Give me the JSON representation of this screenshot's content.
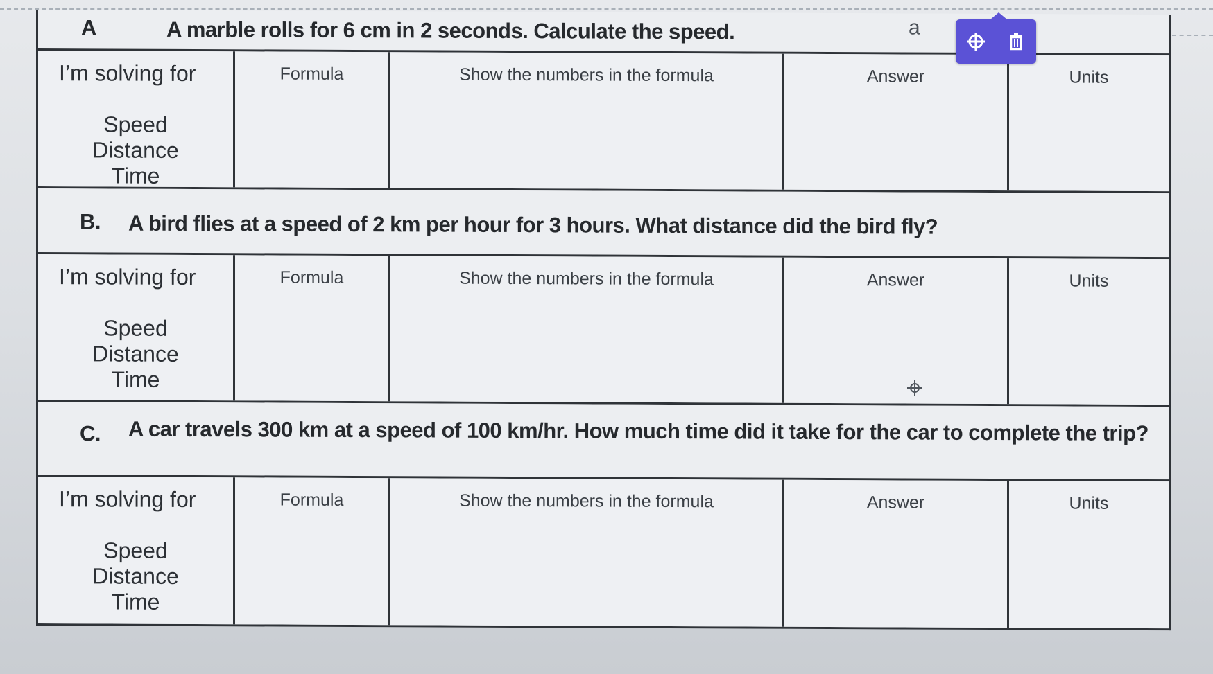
{
  "questions": [
    {
      "letter": "A",
      "text": "A marble rolls for 6 cm in 2 seconds.  Calculate the speed."
    },
    {
      "letter": "B.",
      "text": "A bird flies at a speed of 2 km per hour for 3 hours.  What distance did the bird fly?"
    },
    {
      "letter": "C.",
      "text": "A car travels 300 km at a speed of 100 km/hr.  How much time did it take for the car to complete the trip?"
    }
  ],
  "table_headers": {
    "solving_for": "I’m solving for",
    "formula": "Formula",
    "show_numbers": "Show the numbers in the formula",
    "answer": "Answer",
    "units": "Units"
  },
  "solve_options": {
    "speed": "Speed",
    "distance": "Distance",
    "time": "Time"
  },
  "mark": "a",
  "toolbar": {
    "move_icon": "move-icon",
    "delete_icon": "trash-icon",
    "accent": "#5b52d6"
  }
}
